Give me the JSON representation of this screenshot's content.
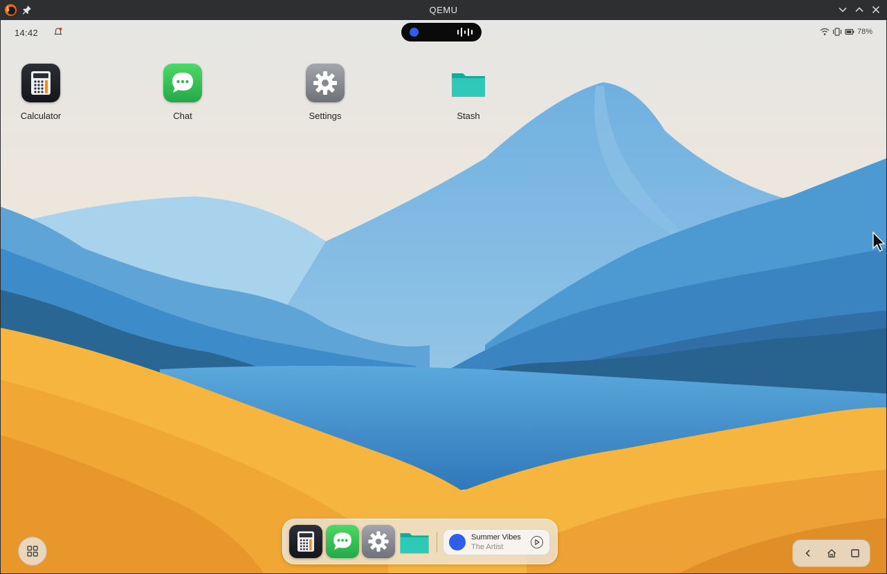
{
  "window": {
    "title": "QEMU"
  },
  "status_bar": {
    "time": "14:42",
    "battery": "78%"
  },
  "desktop_icons": [
    {
      "label": "Calculator",
      "icon": "calculator-icon"
    },
    {
      "label": "Chat",
      "icon": "chat-icon"
    },
    {
      "label": "Settings",
      "icon": "settings-icon"
    },
    {
      "label": "Stash",
      "icon": "folder-icon"
    }
  ],
  "dock": {
    "apps": [
      "calculator-icon",
      "chat-icon",
      "settings-icon",
      "folder-icon"
    ],
    "media": {
      "title": "Summer Vibes",
      "artist": "The Artist"
    }
  },
  "colors": {
    "titlebar": "#2d2f31",
    "accent_blue": "#2f5fe8",
    "chat_green": "#34c759",
    "folder_teal": "#1fb5a8"
  }
}
